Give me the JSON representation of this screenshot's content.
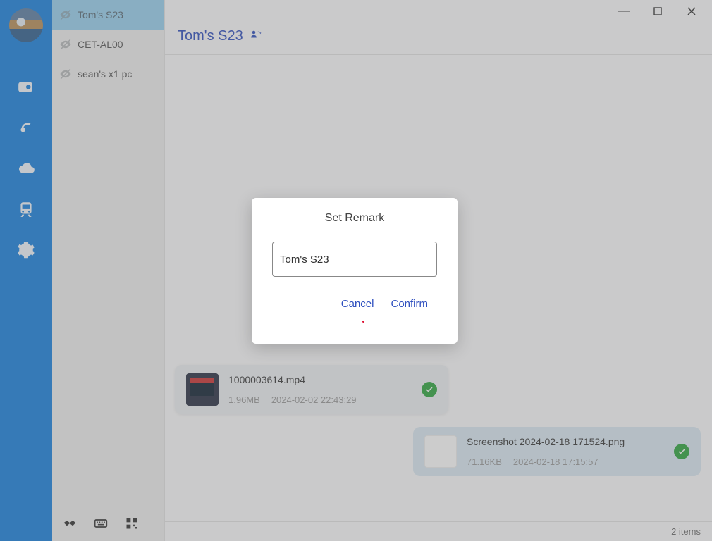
{
  "sidebar": {
    "icons": [
      "camera-icon",
      "broadcast-icon",
      "cloud-icon",
      "train-icon",
      "settings-icon"
    ]
  },
  "devices": {
    "items": [
      {
        "label": "Tom's S23",
        "hidden": true,
        "active": true
      },
      {
        "label": "CET-AL00",
        "hidden": true,
        "active": false
      },
      {
        "label": "sean's x1 pc",
        "hidden": true,
        "active": false
      }
    ],
    "bottom_icons": [
      "handshake-icon",
      "keyboard-icon",
      "qr-icon"
    ]
  },
  "header": {
    "title": "Tom's S23",
    "icon": "contact-card-icon"
  },
  "messages": [
    {
      "side": "left",
      "thumb": "video",
      "filename": "1000003614.mp4",
      "size": "1.96MB",
      "time": "2024-02-02 22:43:29",
      "status": "done"
    },
    {
      "side": "right",
      "thumb": "image",
      "filename": "Screenshot 2024-02-18 171524.png",
      "size": "71.16KB",
      "time": "2024-02-18 17:15:57",
      "status": "done"
    }
  ],
  "footer": {
    "item_count_text": "2 items"
  },
  "dialog": {
    "title": "Set Remark",
    "input_value": "Tom's S23",
    "cancel": "Cancel",
    "confirm": "Confirm"
  },
  "window": {
    "min": "—",
    "max": "▢",
    "close": "✕"
  }
}
